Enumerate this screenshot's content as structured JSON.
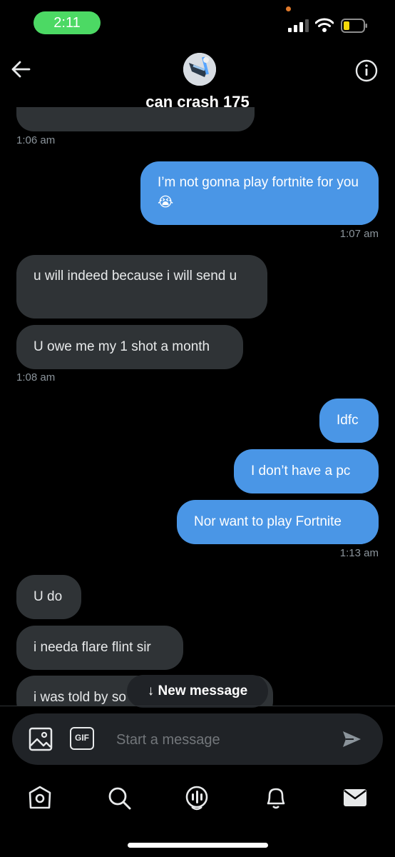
{
  "status_bar": {
    "time": "2:11"
  },
  "header": {
    "title": "can crash 175"
  },
  "messages": [
    {
      "kind": "incoming",
      "text": "u will indeed because i will send u"
    },
    {
      "kind": "incoming",
      "text": "U owe me my 1 shot a month"
    },
    {
      "kind": "outgoing",
      "text": "I’m not gonna play fortnite for you😭"
    },
    {
      "kind": "outgoing",
      "text": "Idfc"
    },
    {
      "kind": "outgoing",
      "text": "I don’t have a pc"
    },
    {
      "kind": "outgoing",
      "text": "Nor want to play Fortnite"
    },
    {
      "kind": "incoming",
      "text": "U do"
    },
    {
      "kind": "incoming",
      "text": "i needa flare flint sir"
    },
    {
      "kind": "incoming",
      "text": "i was told by so"
    }
  ],
  "timestamps": [
    "1:06 am",
    "1:07 am",
    "1:08 am",
    "1:13 am"
  ],
  "new_message_label": "↓ New message",
  "composer": {
    "placeholder": "Start a message",
    "gif_label": "GIF"
  },
  "colors": {
    "outgoing_bubble": "#4a96e6",
    "incoming_bubble": "#2f3336",
    "background": "#000000",
    "status_pill": "#4cd964"
  },
  "icons": [
    "back-arrow-icon",
    "info-icon",
    "image-icon",
    "gif-icon",
    "send-icon",
    "home-icon",
    "search-icon",
    "spaces-icon",
    "notifications-icon",
    "messages-icon"
  ]
}
